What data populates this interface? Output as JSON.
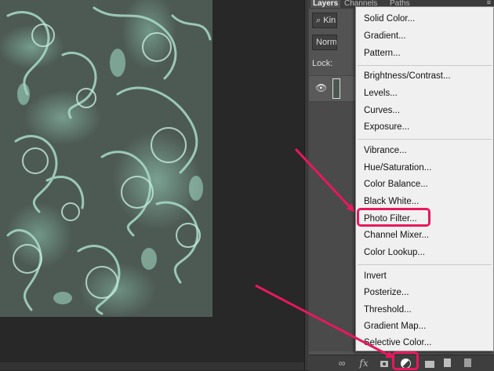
{
  "panel": {
    "tabs": [
      "Layers",
      "Channels",
      "Paths"
    ],
    "menu_icon": "≡",
    "filter_label": "Kin",
    "blend_mode": "Norm",
    "lock_label": "Lock:"
  },
  "toolbar_icons": [
    "link-icon",
    "fx-icon",
    "add-mask-icon",
    "adjustment-layer-icon",
    "group-folder-icon",
    "new-layer-icon",
    "trash-icon"
  ],
  "toolbar": {
    "fx_label": "fx"
  },
  "adjustment_menu": {
    "groups": [
      [
        "Solid Color...",
        "Gradient...",
        "Pattern..."
      ],
      [
        "Brightness/Contrast...",
        "Levels...",
        "Curves...",
        "Exposure..."
      ],
      [
        "Vibrance...",
        "Hue/Saturation...",
        "Color Balance...",
        "Black  White...",
        "Photo Filter...",
        "Channel Mixer...",
        "Color Lookup..."
      ],
      [
        "Invert",
        "Posterize...",
        "Threshold...",
        "Gradient Map...",
        "Selective Color..."
      ]
    ],
    "highlighted_item": "Photo Filter..."
  },
  "annotation_color": "#e8185d"
}
